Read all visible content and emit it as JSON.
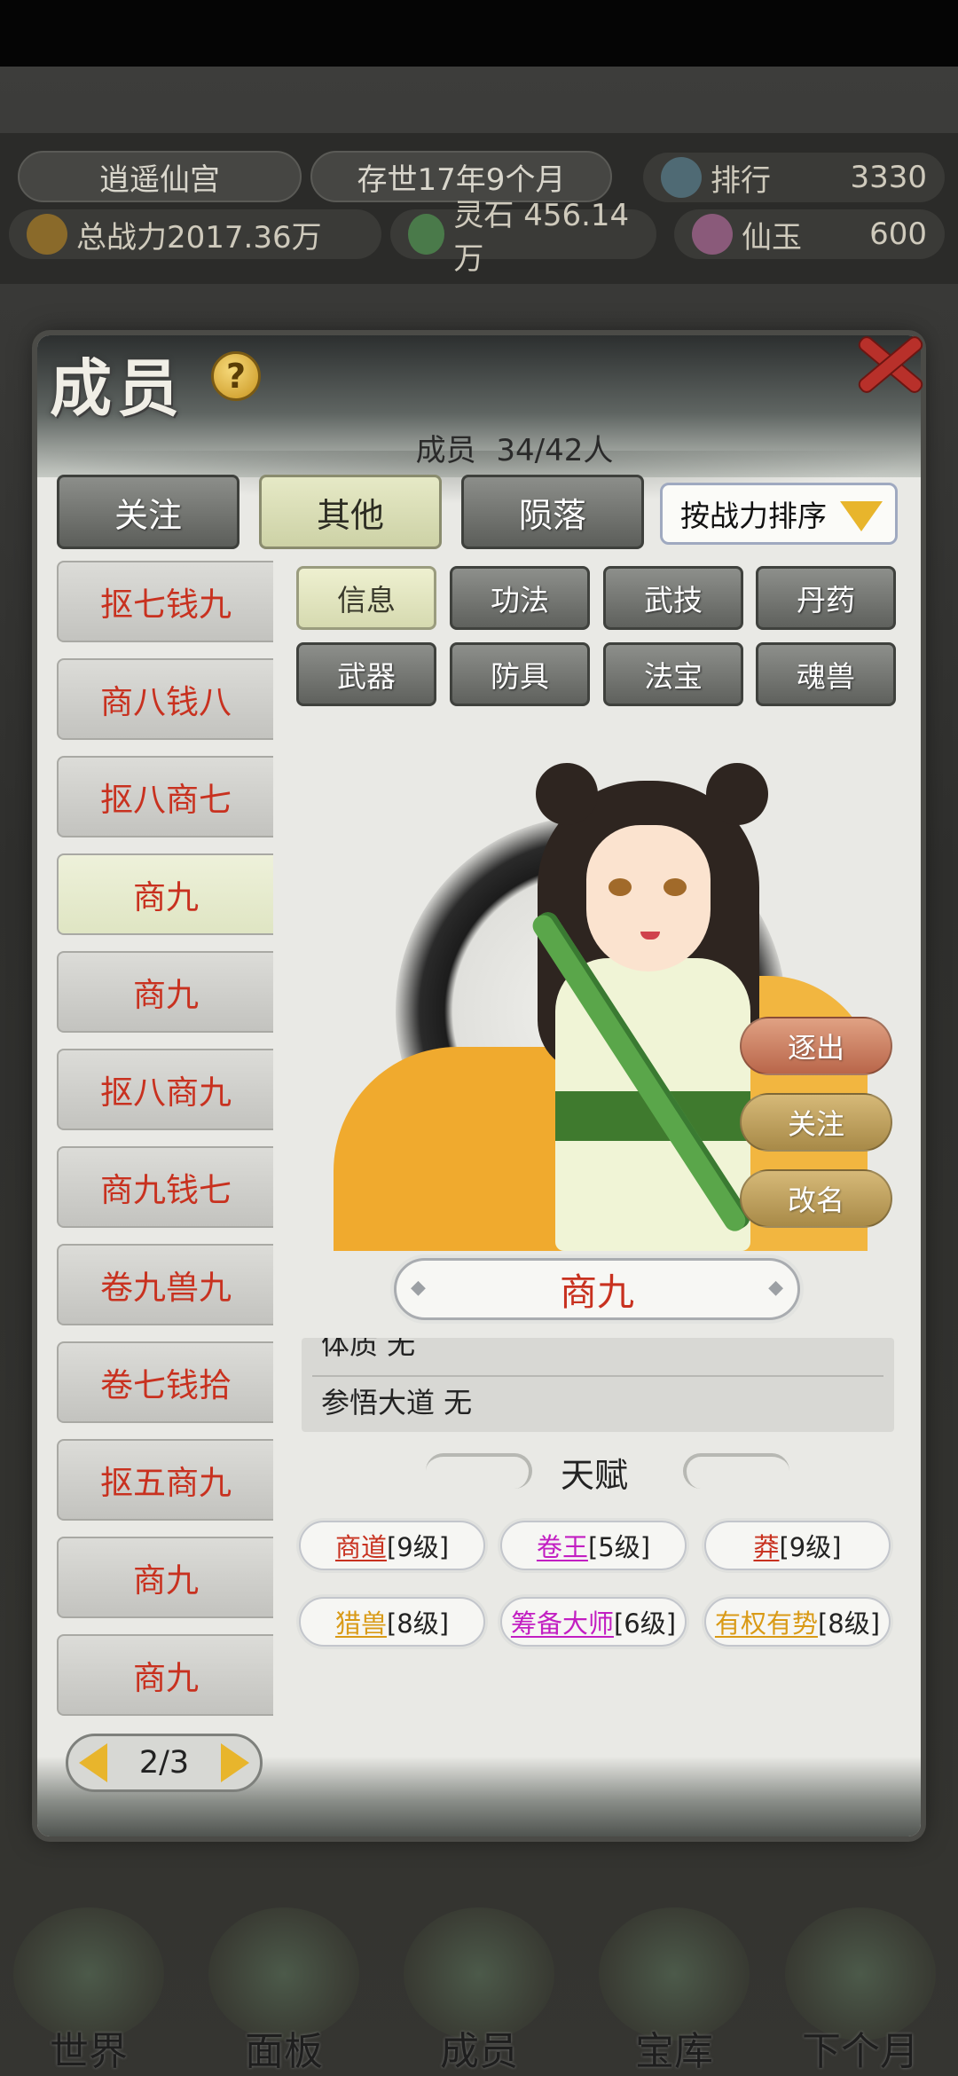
{
  "colors": {
    "member_red": "#c8311f",
    "talent_red": "#c8311f",
    "talent_magenta": "#c21ec2",
    "talent_gold": "#d99a16",
    "active_tab": "#d6dab0",
    "inactive_tab": "#6c6e6a",
    "accent_gold": "#e8b52c"
  },
  "background": {
    "sect_name": "逍遥仙宫",
    "time_text": "存世17年9个月",
    "rank_label": "排行",
    "rank_value": "3330",
    "power_text": "总战力2017.36万",
    "spirit_stone_text": "灵石 456.14万",
    "jade_label": "仙玉",
    "jade_value": "600",
    "nav": [
      {
        "label": "世界",
        "icon": "world-icon"
      },
      {
        "label": "面板",
        "icon": "panel-icon"
      },
      {
        "label": "成员",
        "icon": "member-icon"
      },
      {
        "label": "宝库",
        "icon": "treasury-icon"
      },
      {
        "label": "下个月",
        "icon": "next-month-icon"
      }
    ]
  },
  "panel": {
    "title": "成员",
    "help_icon": "?",
    "count_label": "成员",
    "count_value": "34/42人",
    "tabs": [
      {
        "label": "关注",
        "active": false
      },
      {
        "label": "其他",
        "active": true
      },
      {
        "label": "陨落",
        "active": false
      }
    ],
    "sort_label": "按战力排序",
    "members": [
      {
        "name": "抠七钱九",
        "active": false
      },
      {
        "name": "商八钱八",
        "active": false
      },
      {
        "name": "抠八商七",
        "active": false
      },
      {
        "name": "商九",
        "active": true
      },
      {
        "name": "商九",
        "active": false
      },
      {
        "name": "抠八商九",
        "active": false
      },
      {
        "name": "商九钱七",
        "active": false
      },
      {
        "name": "卷九兽九",
        "active": false
      },
      {
        "name": "卷七钱拾",
        "active": false
      },
      {
        "name": "抠五商九",
        "active": false
      },
      {
        "name": "商九",
        "active": false
      },
      {
        "name": "商九",
        "active": false
      }
    ],
    "pager_text": "2/3",
    "sub_tabs": [
      {
        "label": "信息",
        "active": true
      },
      {
        "label": "功法",
        "active": false
      },
      {
        "label": "武技",
        "active": false
      },
      {
        "label": "丹药",
        "active": false
      },
      {
        "label": "武器",
        "active": false
      },
      {
        "label": "防具",
        "active": false
      },
      {
        "label": "法宝",
        "active": false
      },
      {
        "label": "魂兽",
        "active": false
      }
    ],
    "actions": {
      "expel": "逐出",
      "follow": "关注",
      "rename": "改名"
    },
    "selected_name": "商九",
    "info": {
      "physique": "体质 无",
      "enlightenment": "参悟大道 无"
    },
    "talent_title": "天赋",
    "talents": [
      {
        "name": "商道",
        "level": "[9级]",
        "color": "#c8311f"
      },
      {
        "name": "卷王",
        "level": "[5级]",
        "color": "#c21ec2"
      },
      {
        "name": "莽",
        "level": "[9级]",
        "color": "#c8311f"
      },
      {
        "name": "猎兽",
        "level": "[8级]",
        "color": "#d99a16"
      },
      {
        "name": "筹备大师",
        "level": "[6级]",
        "color": "#c21ec2"
      },
      {
        "name": "有权有势",
        "level": "[8级]",
        "color": "#d99a16"
      }
    ]
  }
}
